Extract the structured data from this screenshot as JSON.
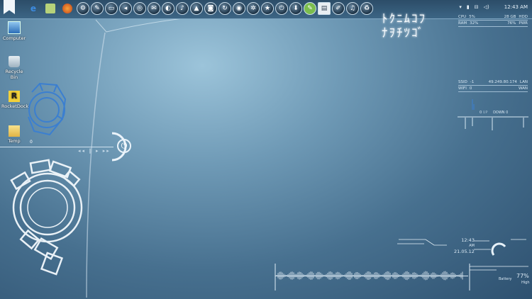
{
  "taskbar": {
    "clock": "12:43 AM"
  },
  "desktop_icons": [
    {
      "label": "Computer"
    },
    {
      "label": "Recycle Bin"
    },
    {
      "label": "RocketDock"
    },
    {
      "label": "Temp"
    }
  ],
  "temp_counter": "0",
  "system_meter": {
    "rows": [
      {
        "k1": "CPU",
        "v1": "5%",
        "v2": "28 GB",
        "k2": "HDD"
      },
      {
        "k1": "RAM",
        "v1": "32%",
        "v2": "76%",
        "k2": "PWR"
      }
    ]
  },
  "network_meter": {
    "rows": [
      {
        "k1": "SSID",
        "v1": "-1",
        "v2": "49.249.80.174",
        "k2": "LAN"
      },
      {
        "k1": "WIFI",
        "v1": "0",
        "v2": "",
        "k2": "WAN"
      }
    ],
    "up_value": "0",
    "up_label": "UP",
    "down_label": "DOWN",
    "down_value": "0"
  },
  "kanji_clock": {
    "line1": "ﾄｸﾆﾑｺﾌ",
    "line2": "ﾅｦﾁﾂｺﾞ"
  },
  "date_widget": {
    "time": "12:43",
    "ampm": "AM",
    "date": "21.05.12"
  },
  "battery": {
    "percent": "77%",
    "label": "Battery",
    "status": "High"
  },
  "colors": {
    "background_center": "#9cc4da",
    "background_edge": "#2e5170",
    "accent_blue": "#3b7fd0",
    "hud_white": "#eef6fb"
  }
}
